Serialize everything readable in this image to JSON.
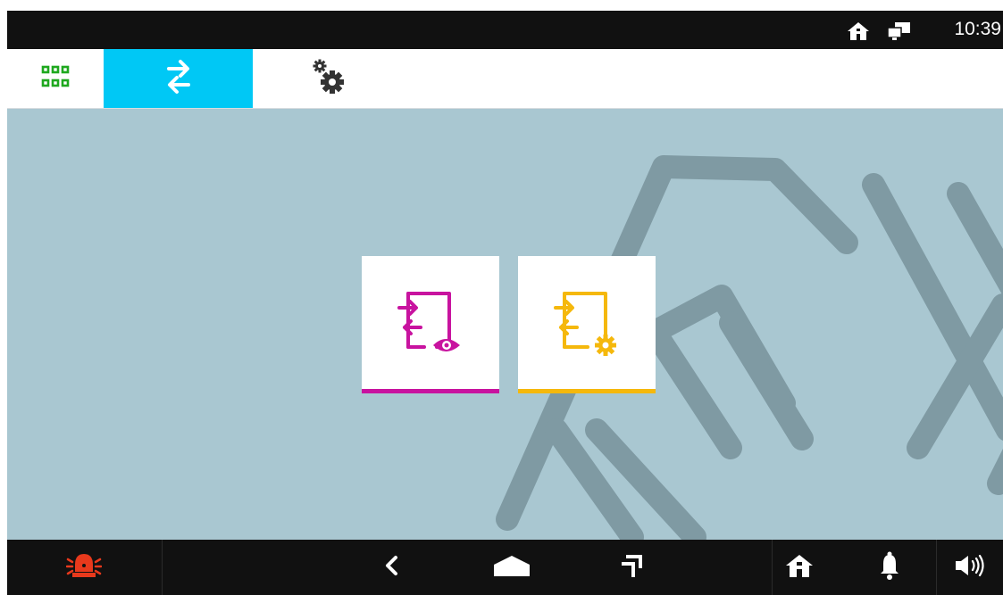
{
  "status_bar": {
    "time": "10:39",
    "icons": [
      "home-icon",
      "network-icon"
    ]
  },
  "tabs": [
    {
      "name": "apps",
      "icon": "grid-icon",
      "active": false
    },
    {
      "name": "transfer",
      "icon": "transfer-arrows-icon",
      "active": true
    },
    {
      "name": "settings",
      "icon": "gears-icon",
      "active": false
    }
  ],
  "tiles": [
    {
      "name": "transfer-view",
      "icon": "transfer-view-icon",
      "color": "#c8139f"
    },
    {
      "name": "transfer-settings",
      "icon": "transfer-settings-icon",
      "color": "#f5b80c"
    }
  ],
  "bottom_bar": {
    "items": [
      "alarm-icon",
      "back-icon",
      "home-nav-icon",
      "recents-icon",
      "home-icon",
      "bell-icon",
      "volume-icon"
    ]
  },
  "colors": {
    "accent": "#00c8f5",
    "grid_green": "#1fa81f",
    "alarm_red": "#e8391c",
    "background": "#a9c7d1",
    "art": "#7f9aa3"
  }
}
